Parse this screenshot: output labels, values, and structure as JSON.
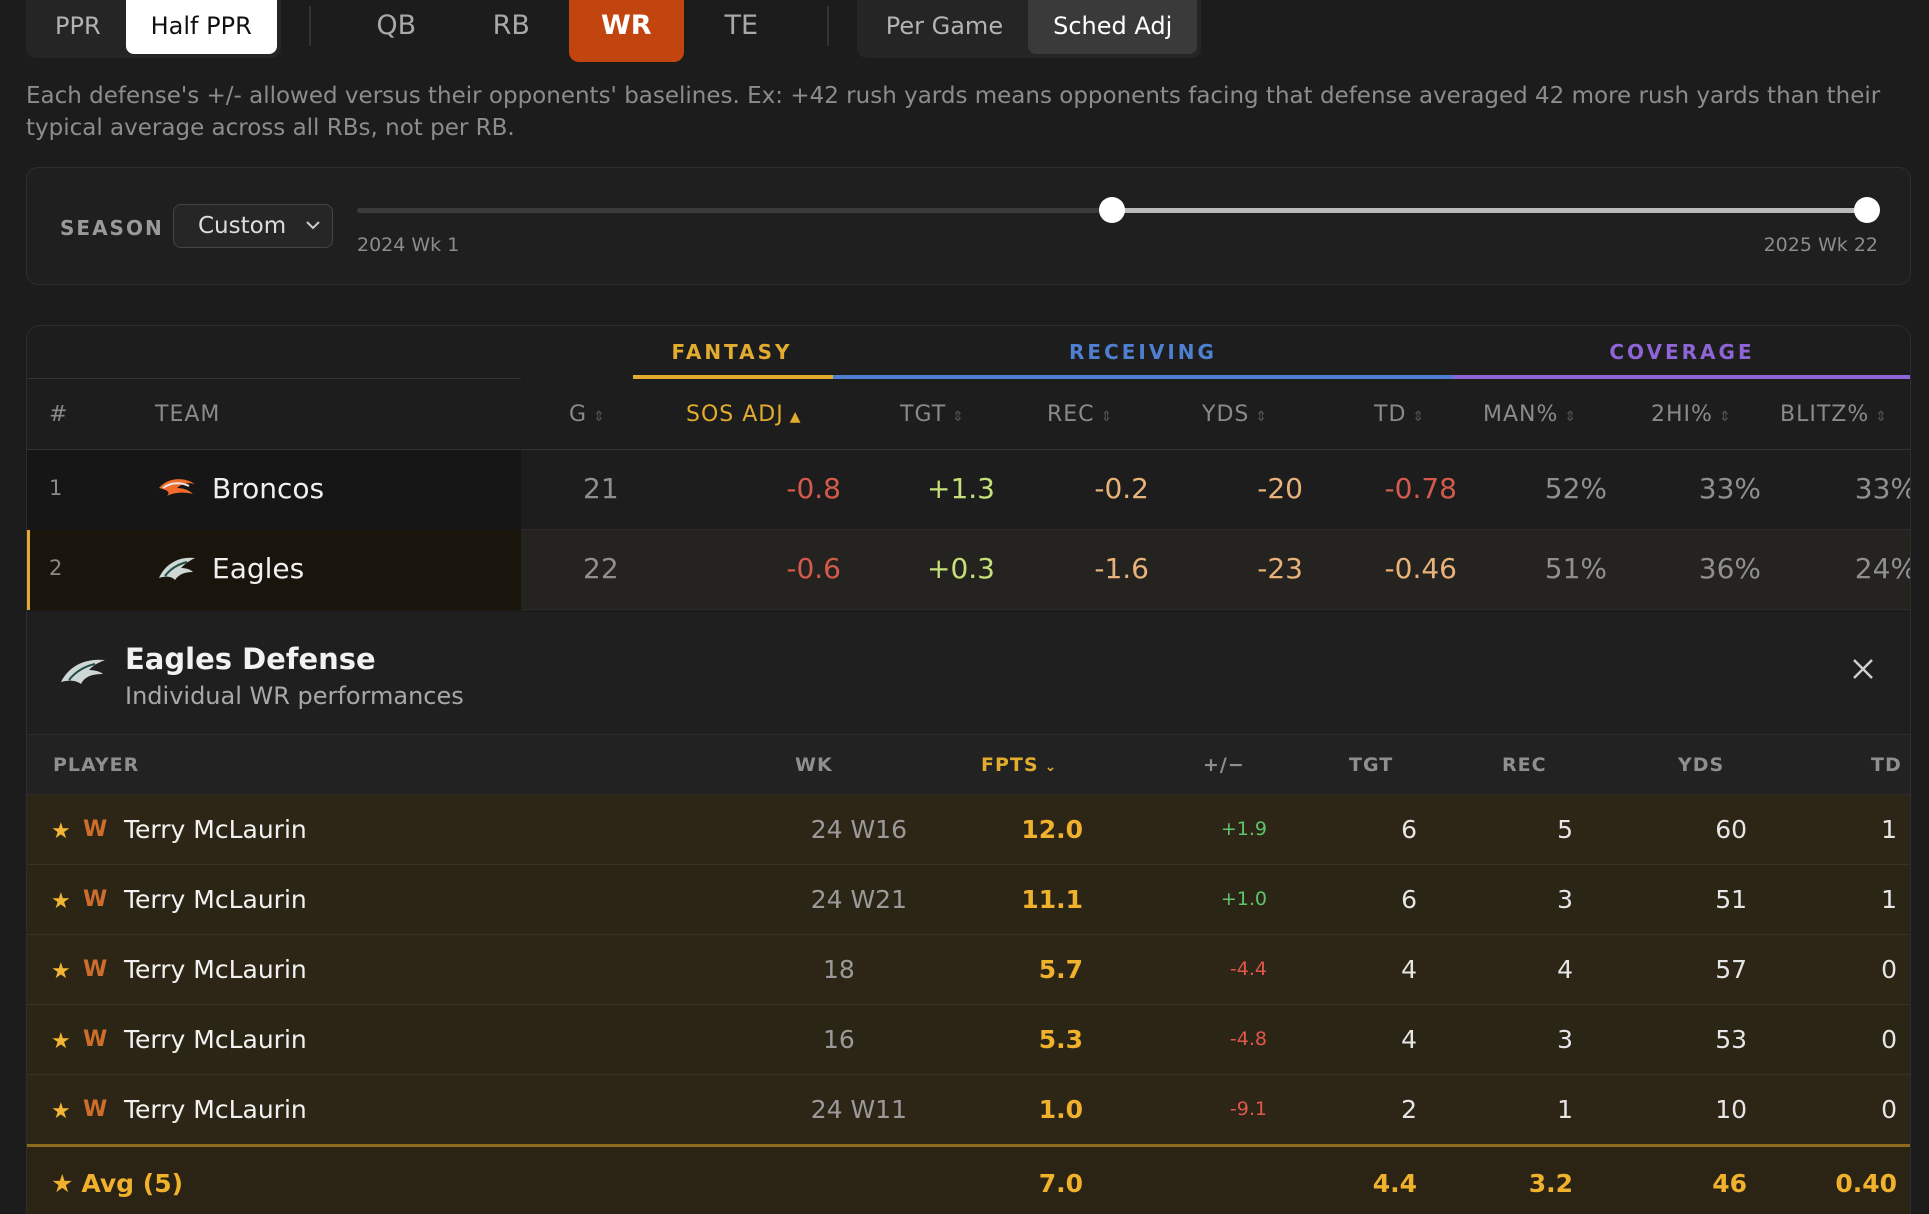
{
  "scoring": {
    "options": [
      "PPR",
      "Half PPR"
    ],
    "selected": "Half PPR"
  },
  "positions": {
    "options": [
      "QB",
      "RB",
      "WR",
      "TE"
    ],
    "selected": "WR"
  },
  "mode": {
    "options": [
      "Per Game",
      "Sched Adj"
    ],
    "selected": "Sched Adj"
  },
  "description": "Each defense's +/- allowed versus their opponents' baselines. Ex: +42 rush yards means opponents facing that defense averaged 42 more rush yards than their typical average across all RBs, not per RB.",
  "season": {
    "label": "SEASON",
    "select_value": "Custom",
    "range_min_label": "2024 Wk 1",
    "range_max_label": "2025 Wk 22",
    "range_start_fraction": 0.5,
    "range_end_fraction": 1.0
  },
  "groups": {
    "fantasy": "FANTASY",
    "receiving": "RECEIVING",
    "coverage": "COVERAGE"
  },
  "colors": {
    "fantasy": "#e2ac2e",
    "receiving": "#4f7fd0",
    "coverage": "#8e65d6",
    "accent": "#c2440e"
  },
  "columns": {
    "rank": "#",
    "team": "TEAM",
    "g": "G",
    "sos": "SOS ADJ",
    "tgt": "TGT",
    "rec": "REC",
    "yds": "YDS",
    "td": "TD",
    "man": "MAN%",
    "hi2": "2HI%",
    "blitz": "BLITZ%"
  },
  "teams": [
    {
      "rank": "1",
      "name": "Broncos",
      "logo": "broncos-logo",
      "g": "21",
      "sos": "-0.8",
      "tgt": "+1.3",
      "rec": "-0.2",
      "yds": "-20",
      "td": "-0.78",
      "man": "52%",
      "hi2": "33%",
      "blitz": "33%"
    },
    {
      "rank": "2",
      "name": "Eagles",
      "logo": "eagles-logo",
      "g": "22",
      "sos": "-0.6",
      "tgt": "+0.3",
      "rec": "-1.6",
      "yds": "-23",
      "td": "-0.46",
      "man": "51%",
      "hi2": "36%",
      "blitz": "24%"
    }
  ],
  "detail": {
    "title": "Eagles Defense",
    "subtitle": "Individual WR performances",
    "columns": {
      "player": "PLAYER",
      "wk": "WK",
      "fpts": "FPTS",
      "pm": "+/−",
      "tgt": "TGT",
      "rec": "REC",
      "yds": "YDS",
      "td": "TD"
    },
    "rows": [
      {
        "team": "W",
        "player": "Terry McLaurin",
        "wk": "24 W16",
        "fpts": "12.0",
        "pm": "+1.9",
        "tgt": "6",
        "rec": "5",
        "yds": "60",
        "td": "1"
      },
      {
        "team": "W",
        "player": "Terry McLaurin",
        "wk": "24 W21",
        "fpts": "11.1",
        "pm": "+1.0",
        "tgt": "6",
        "rec": "3",
        "yds": "51",
        "td": "1"
      },
      {
        "team": "W",
        "player": "Terry McLaurin",
        "wk": "18",
        "fpts": "5.7",
        "pm": "-4.4",
        "tgt": "4",
        "rec": "4",
        "yds": "57",
        "td": "0"
      },
      {
        "team": "W",
        "player": "Terry McLaurin",
        "wk": "16",
        "fpts": "5.3",
        "pm": "-4.8",
        "tgt": "4",
        "rec": "3",
        "yds": "53",
        "td": "0"
      },
      {
        "team": "W",
        "player": "Terry McLaurin",
        "wk": "24 W11",
        "fpts": "1.0",
        "pm": "-9.1",
        "tgt": "2",
        "rec": "1",
        "yds": "10",
        "td": "0"
      }
    ],
    "avg": {
      "label": "Avg (5)",
      "fpts": "7.0",
      "tgt": "4.4",
      "rec": "3.2",
      "yds": "46",
      "td": "0.40"
    }
  }
}
